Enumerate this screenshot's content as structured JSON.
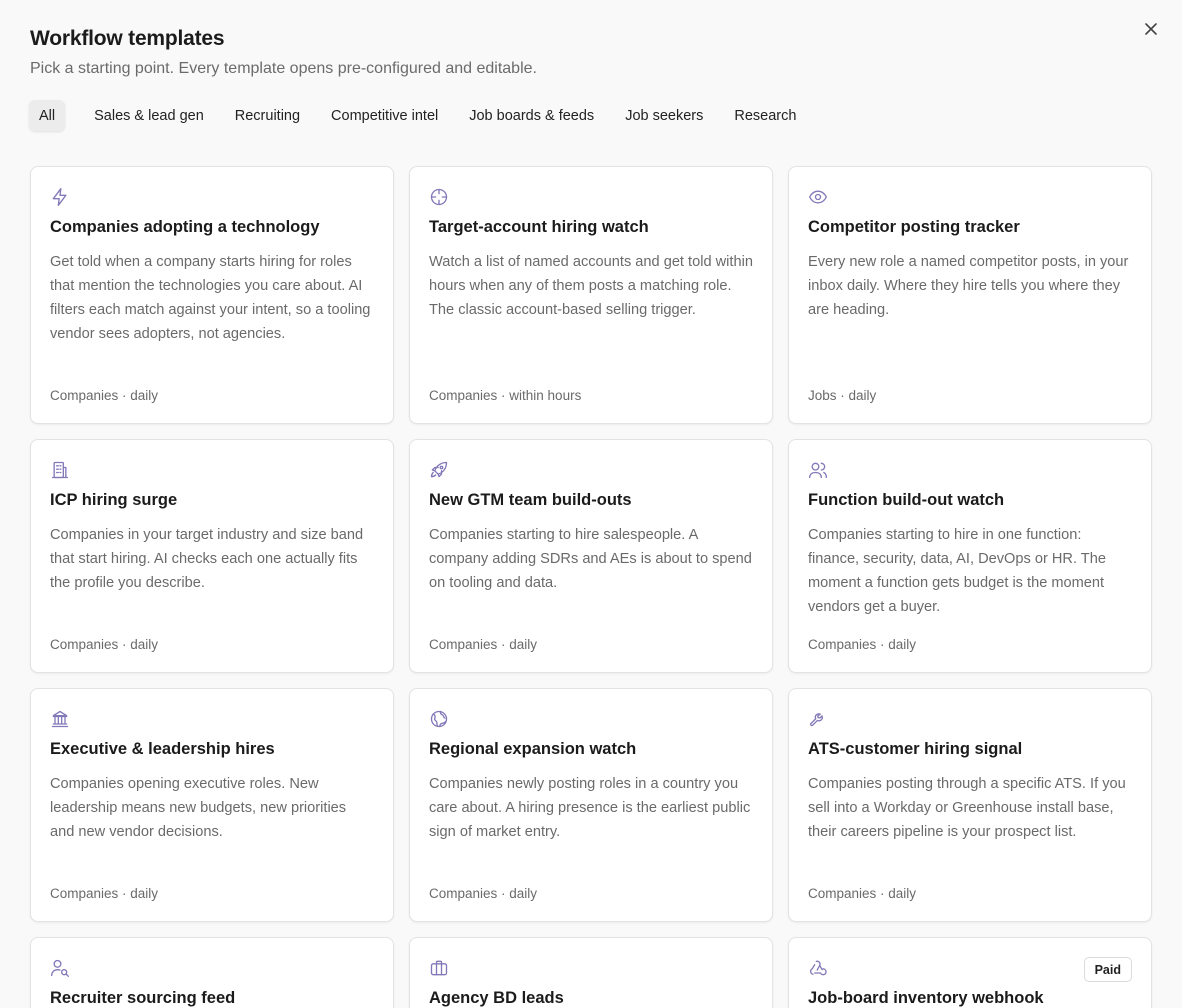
{
  "header": {
    "title": "Workflow templates",
    "subtitle": "Pick a starting point. Every template opens pre-configured and editable.",
    "close_icon": "close-icon"
  },
  "tabs": [
    {
      "label": "All",
      "active": true
    },
    {
      "label": "Sales & lead gen",
      "active": false
    },
    {
      "label": "Recruiting",
      "active": false
    },
    {
      "label": "Competitive intel",
      "active": false
    },
    {
      "label": "Job boards & feeds",
      "active": false
    },
    {
      "label": "Job seekers",
      "active": false
    },
    {
      "label": "Research",
      "active": false
    }
  ],
  "accent_color": "#8279b8",
  "cards": [
    {
      "icon": "lightning-icon",
      "title": "Companies adopting a technology",
      "description": "Get told when a company starts hiring for roles that mention the technologies you care about. AI filters each match against your intent, so a tooling vendor sees adopters, not agencies.",
      "meta": "Companies · daily"
    },
    {
      "icon": "crosshair-icon",
      "title": "Target-account hiring watch",
      "description": "Watch a list of named accounts and get told within hours when any of them posts a matching role. The classic account-based selling trigger.",
      "meta": "Companies · within hours"
    },
    {
      "icon": "eye-icon",
      "title": "Competitor posting tracker",
      "description": "Every new role a named competitor posts, in your inbox daily. Where they hire tells you where they are heading.",
      "meta": "Jobs · daily"
    },
    {
      "icon": "building-icon",
      "title": "ICP hiring surge",
      "description": "Companies in your target industry and size band that start hiring. AI checks each one actually fits the profile you describe.",
      "meta": "Companies · daily"
    },
    {
      "icon": "rocket-icon",
      "title": "New GTM team build-outs",
      "description": "Companies starting to hire salespeople. A company adding SDRs and AEs is about to spend on tooling and data.",
      "meta": "Companies · daily"
    },
    {
      "icon": "users-icon",
      "title": "Function build-out watch",
      "description": "Companies starting to hire in one function: finance, security, data, AI, DevOps or HR. The moment a function gets budget is the moment vendors get a buyer.",
      "meta": "Companies · daily"
    },
    {
      "icon": "landmark-icon",
      "title": "Executive & leadership hires",
      "description": "Companies opening executive roles. New leadership means new budgets, new priorities and new vendor decisions.",
      "meta": "Companies · daily"
    },
    {
      "icon": "globe-icon",
      "title": "Regional expansion watch",
      "description": "Companies newly posting roles in a country you care about. A hiring presence is the earliest public sign of market entry.",
      "meta": "Companies · daily"
    },
    {
      "icon": "wrench-icon",
      "title": "ATS-customer hiring signal",
      "description": "Companies posting through a specific ATS. If you sell into a Workday or Greenhouse install base, their careers pipeline is your prospect list.",
      "meta": "Companies · daily"
    },
    {
      "icon": "user-search-icon",
      "title": "Recruiter sourcing feed",
      "description": "",
      "meta": ""
    },
    {
      "icon": "briefcase-icon",
      "title": "Agency BD leads",
      "description": "",
      "meta": ""
    },
    {
      "icon": "webhook-icon",
      "title": "Job-board inventory webhook",
      "description": "",
      "meta": "",
      "badge": "Paid"
    }
  ]
}
